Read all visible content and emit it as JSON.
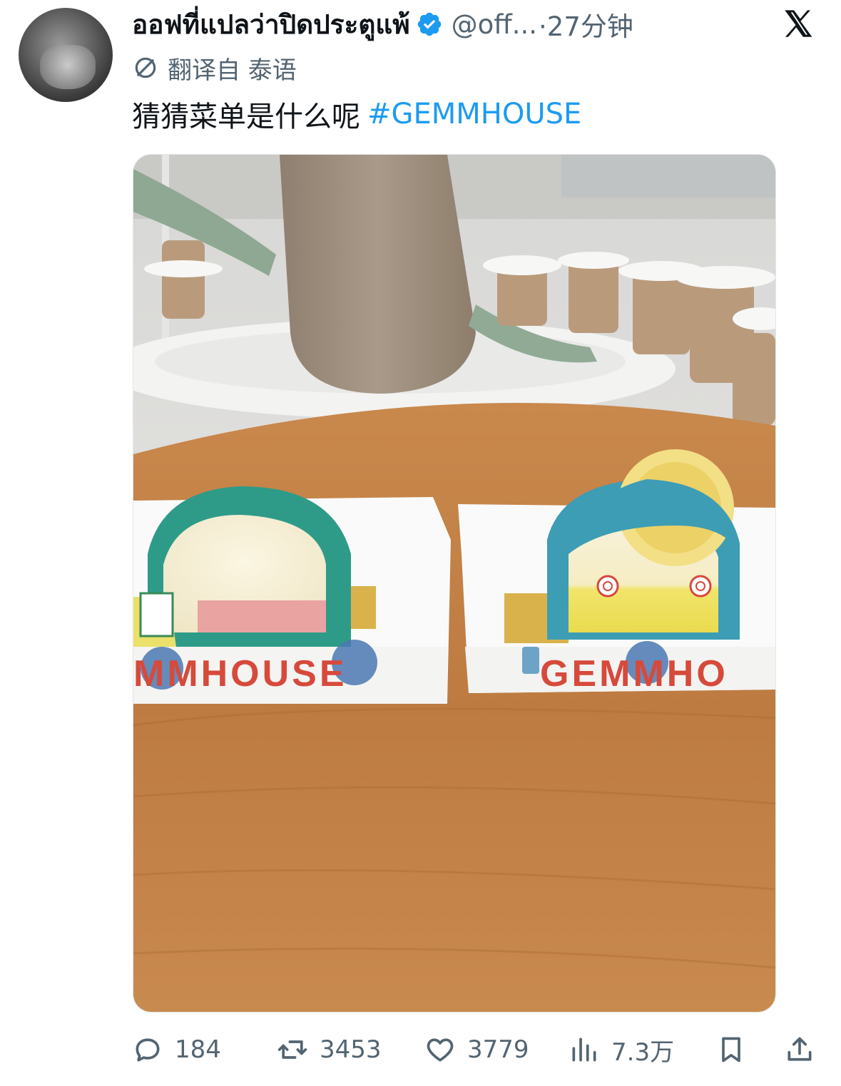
{
  "author": {
    "display_name": "ออฟที่แปลว่าปิดประตูแพ้",
    "handle": "@off...",
    "time": "·27分钟"
  },
  "translation": {
    "label": "翻译自 泰语"
  },
  "tweet": {
    "text": "猜猜菜单是什么呢",
    "hashtag": "#GEMMHOUSE"
  },
  "media": {
    "box_left_text": "MMHOUSE",
    "box_right_text": "GEMMHO"
  },
  "actions": {
    "replies": "184",
    "reposts": "3453",
    "likes": "3779",
    "views": "7.3万"
  },
  "colors": {
    "link": "#1d9bf0",
    "verified": "#1d9bf0",
    "muted": "#536471"
  },
  "icons": [
    "verified-badge-icon",
    "x-logo-icon",
    "translate-icon",
    "reply-icon",
    "repost-icon",
    "like-icon",
    "views-icon",
    "bookmark-icon",
    "share-icon"
  ]
}
